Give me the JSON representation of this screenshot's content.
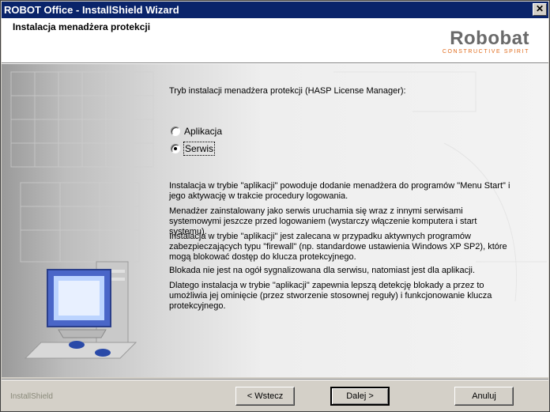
{
  "window": {
    "title": "ROBOT Office - InstallShield Wizard",
    "close_glyph": "✕"
  },
  "header": {
    "title": "Instalacja menadżera protekcji",
    "logo_main": "Robobat",
    "logo_sub": "CONSTRUCTIVE SPIRIT"
  },
  "content": {
    "prompt": "Tryb instalacji menadżera protekcji (HASP License Manager):",
    "options": [
      {
        "label": "Aplikacja",
        "selected": false
      },
      {
        "label": "Serwis",
        "selected": true
      }
    ],
    "paragraphs": [
      "Instalacja w trybie \"aplikacji\" powoduje dodanie menadżera do programów \"Menu Start\" i jego aktywację w trakcie procedury logowania.",
      "Menadżer zainstalowany jako serwis uruchamia się wraz z innymi serwisami systemowymi jeszcze przed logowaniem (wystarczy włączenie komputera i start systemu).",
      "Instalacja w trybie \"aplikacji\" jest zalecana w przypadku aktywnych programów zabezpieczających typu \"firewall\" (np. standardowe ustawienia Windows XP SP2), które mogą blokować dostęp do klucza protekcyjnego.",
      "Blokada nie jest na ogół sygnalizowana dla serwisu, natomiast jest dla aplikacji.",
      "Dlatego instalacja w trybie \"aplikacji\" zapewnia lepszą detekcję blokady a przez to umożliwia jej ominięcie (przez stworzenie stosownej reguły) i funkcjonowanie klucza protekcyjnego."
    ]
  },
  "footer": {
    "brand": "InstallShield",
    "back_label": "< Wstecz",
    "next_label": "Dalej >",
    "cancel_label": "Anuluj"
  },
  "colors": {
    "titlebar": "#0a246a",
    "dialog": "#d4d0c8",
    "logo_accent": "#e06a1a"
  }
}
